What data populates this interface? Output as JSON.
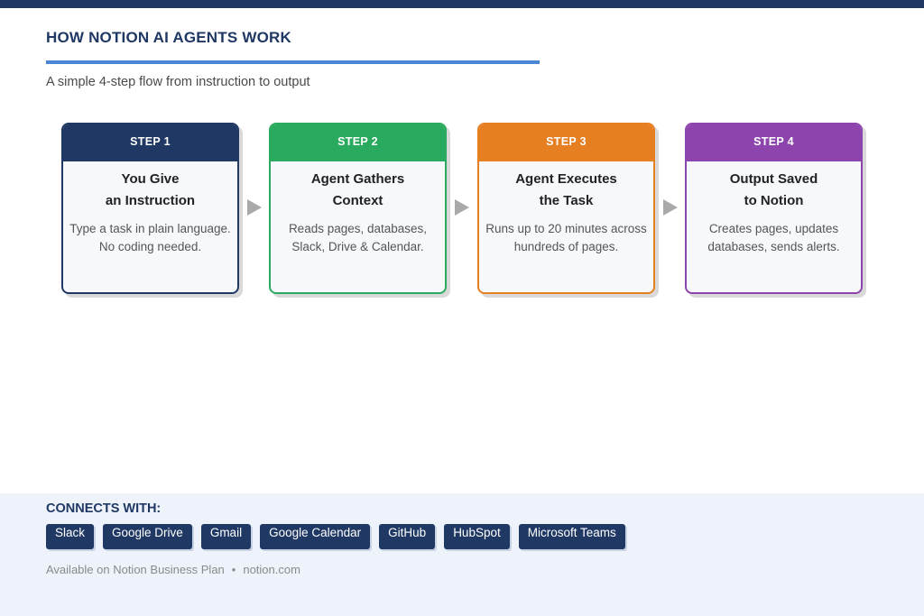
{
  "header": {
    "title": "HOW NOTION AI AGENTS WORK",
    "subtitle": "A simple 4-step flow from instruction to output"
  },
  "steps": [
    {
      "label": "STEP 1",
      "title_lines": [
        "You Give",
        "an Instruction"
      ],
      "desc_lines": [
        "Type a task in plain language.",
        "No coding needed."
      ],
      "color": "#1f3864"
    },
    {
      "label": "STEP 2",
      "title_lines": [
        "Agent Gathers",
        "Context"
      ],
      "desc_lines": [
        "Reads pages, databases,",
        "Slack, Drive & Calendar."
      ],
      "color": "#2aaa5e"
    },
    {
      "label": "STEP 3",
      "title_lines": [
        "Agent Executes",
        "the Task"
      ],
      "desc_lines": [
        "Runs up to 20 minutes across",
        "hundreds of pages."
      ],
      "color": "#e67e22"
    },
    {
      "label": "STEP 4",
      "title_lines": [
        "Output Saved",
        "to Notion"
      ],
      "desc_lines": [
        "Creates pages, updates",
        "databases, sends alerts."
      ],
      "color": "#8e44ad"
    }
  ],
  "connects": {
    "label": "CONNECTS WITH:",
    "integrations": [
      "Slack",
      "Google Drive",
      "Gmail",
      "Google Calendar",
      "GitHub",
      "HubSpot",
      "Microsoft Teams"
    ]
  },
  "footer": {
    "plan": "Available on Notion Business Plan",
    "separator": "•",
    "site": "notion.com"
  }
}
